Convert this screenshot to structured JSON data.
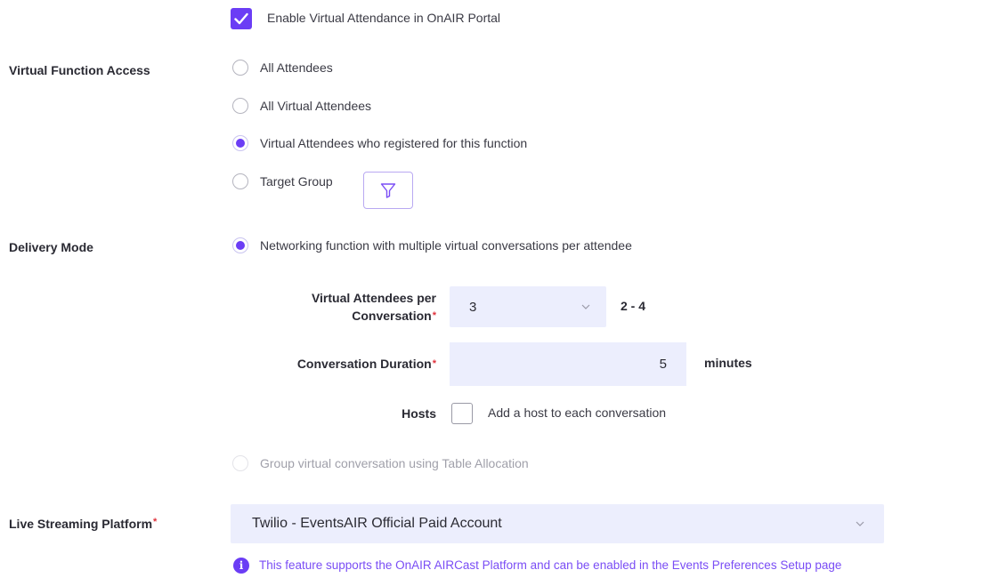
{
  "enable_virtual": {
    "label": "Enable Virtual Attendance in OnAIR Portal",
    "checked": true
  },
  "virtual_function_access": {
    "label": "Virtual Function Access",
    "options": [
      {
        "label": "All Attendees",
        "selected": false
      },
      {
        "label": "All Virtual Attendees",
        "selected": false
      },
      {
        "label": "Virtual Attendees who registered for this function",
        "selected": true
      },
      {
        "label": "Target Group",
        "selected": false
      }
    ],
    "filter_icon": "filter-icon"
  },
  "delivery_mode": {
    "label": "Delivery Mode",
    "option_networking": {
      "label": "Networking function with multiple virtual conversations per attendee",
      "selected": true
    },
    "attendees_per_conversation": {
      "label_line1": "Virtual Attendees per",
      "label_line2": "Conversation",
      "required_mark": "*",
      "value": "3",
      "range": "2 - 4"
    },
    "conversation_duration": {
      "label": "Conversation Duration",
      "required_mark": "*",
      "value": "5",
      "unit": "minutes"
    },
    "hosts": {
      "label": "Hosts",
      "checkbox_label": "Add a host to each conversation",
      "checked": false
    },
    "option_table_allocation": {
      "label": "Group virtual conversation using Table Allocation",
      "selected": false,
      "disabled": true
    }
  },
  "live_streaming": {
    "label": "Live Streaming Platform",
    "required_mark": "*",
    "value": "Twilio - EventsAIR Official Paid Account",
    "info_icon_glyph": "i",
    "info": "This feature supports the OnAIR AIRCast Platform and can be enabled in the Events Preferences Setup page"
  },
  "colors": {
    "accent": "#6b3df5",
    "input_bg": "#eceefd",
    "required": "#e0323c",
    "info_text": "#7a4df5"
  }
}
